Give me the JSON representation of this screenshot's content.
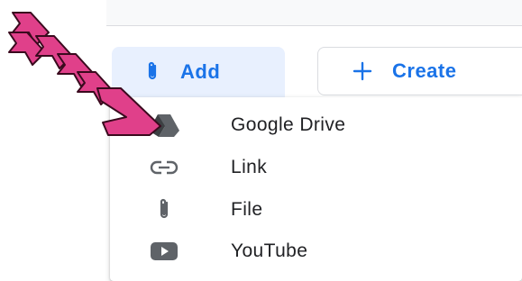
{
  "toolbar": {
    "add_label": "Add",
    "create_label": "Create",
    "add_icon": "paperclip-icon",
    "create_icon": "plus-icon"
  },
  "menu": {
    "items": [
      {
        "label": "Google Drive",
        "icon": "google-drive-icon"
      },
      {
        "label": "Link",
        "icon": "link-icon"
      },
      {
        "label": "File",
        "icon": "paperclip-icon"
      },
      {
        "label": "YouTube",
        "icon": "youtube-icon"
      }
    ]
  },
  "colors": {
    "accent": "#1a73e8",
    "add_button_bg": "#e8f0fe",
    "annotation_arrow": "#e0408a",
    "icon_gray": "#5f6368"
  }
}
